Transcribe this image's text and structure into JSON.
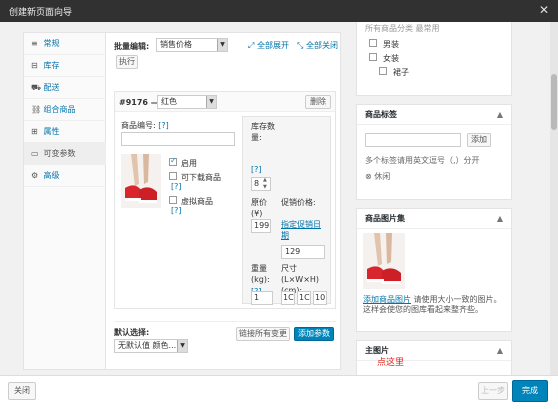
{
  "window": {
    "title": "创建新页面向导",
    "close_glyph": "✕"
  },
  "tabs": [
    {
      "icon": "≡",
      "label": "常规"
    },
    {
      "icon": "⊟",
      "label": "库存"
    },
    {
      "icon": "⛟",
      "label": "配送"
    },
    {
      "icon": "⛓",
      "label": "组合商品"
    },
    {
      "icon": "⊞",
      "label": "属性"
    },
    {
      "icon": "▭",
      "label": "可变参数"
    },
    {
      "icon": "⚙",
      "label": "高级"
    }
  ],
  "bulk": {
    "label": "批量编辑:",
    "select": "销售价格",
    "expand_all": "全部展开",
    "close_all": "全部关闭",
    "execute": "执行"
  },
  "variation": {
    "id": "#9176 —",
    "color_select": "红色",
    "delete": "删除",
    "sku_label": "商品编号:",
    "help": "[?]",
    "enabled": "启用",
    "downloadable": "可下载商品",
    "virtual": "虚拟商品",
    "stock_label": "库存数量:",
    "stock_value": "8",
    "regular_price_label": "原价(¥)",
    "regular_price_value": "199",
    "sale_price_label": "促销价格:",
    "schedule_link": "指定促销日期",
    "sale_price_value": "129",
    "weight_label": "重量(kg):",
    "weight_value": "1",
    "dims_label": "尺寸(L×W×H)(cm):",
    "dim_l": "1C",
    "dim_w": "1C",
    "dim_h": "10"
  },
  "defaults": {
    "label": "默认选择:",
    "select": "无默认值 颜色...",
    "link_all": "链接所有变更",
    "add_variation": "添加参数"
  },
  "categories": {
    "partial_top": "所有商品分类    最常用",
    "items": [
      "男装",
      "女装",
      "裙子"
    ]
  },
  "tags": {
    "title": "商品标签",
    "add": "添加",
    "hint": "多个标签请用英文逗号（,）分开",
    "tag": "休闲"
  },
  "gallery": {
    "title": "商品图片集",
    "add_link": "添加商品图片",
    "desc": "请使用大小一致的图片。这样会使您的图库看起来整齐些。"
  },
  "featured": {
    "title": "主图片"
  },
  "footer": {
    "close": "关闭",
    "finish": "完成",
    "partial_btn": "上一步"
  },
  "annotation": {
    "text": "点这里",
    "color": "#e0241b"
  },
  "colors": {
    "primary": "#0085ba",
    "link": "#0073aa"
  }
}
